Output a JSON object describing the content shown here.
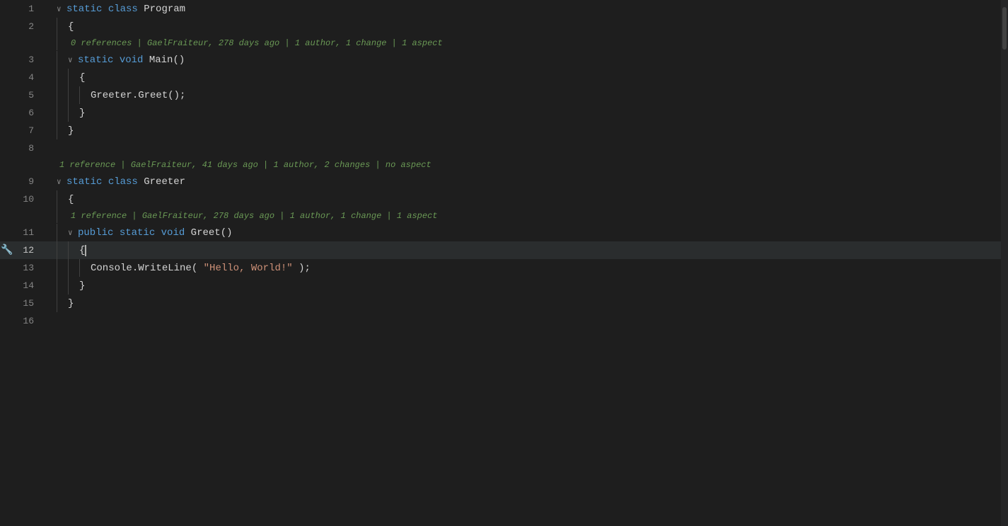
{
  "editor": {
    "background": "#1e1e1e",
    "activeLineBackground": "#2a2d2e",
    "colors": {
      "keyword": "#569cd6",
      "className": "#4ec9b0",
      "methodName": "#dcdcaa",
      "string": "#ce9178",
      "plain": "#d4d4d4",
      "metaInfo": "#6a9955",
      "lineNumber": "#858585",
      "activeLineNumber": "#c6c6c6"
    },
    "lines": [
      {
        "num": 1,
        "indent": 0,
        "foldable": true,
        "folded": false,
        "content": [
          {
            "type": "fold",
            "text": "∨"
          },
          {
            "type": "keyword",
            "text": "static"
          },
          {
            "type": "plain",
            "text": " "
          },
          {
            "type": "keyword",
            "text": "class"
          },
          {
            "type": "plain",
            "text": " "
          },
          {
            "type": "className",
            "text": "Program"
          }
        ],
        "active": false
      },
      {
        "num": 2,
        "indent": 1,
        "foldable": false,
        "content": [
          {
            "type": "plain",
            "text": "{"
          }
        ],
        "active": false
      },
      {
        "num": "meta1",
        "isMeta": true,
        "indent": 1,
        "content": "0 references | GaelFraiteur, 278 days ago | 1 author, 1 change | 1 aspect"
      },
      {
        "num": 3,
        "indent": 1,
        "foldable": true,
        "folded": false,
        "content": [
          {
            "type": "fold",
            "text": "∨"
          },
          {
            "type": "keyword",
            "text": "static"
          },
          {
            "type": "plain",
            "text": " "
          },
          {
            "type": "keyword",
            "text": "void"
          },
          {
            "type": "plain",
            "text": " "
          },
          {
            "type": "methodName",
            "text": "Main"
          },
          {
            "type": "plain",
            "text": "()"
          }
        ],
        "active": false
      },
      {
        "num": 4,
        "indent": 2,
        "content": [
          {
            "type": "plain",
            "text": "{"
          }
        ],
        "active": false
      },
      {
        "num": 5,
        "indent": 3,
        "content": [
          {
            "type": "className",
            "text": "Greeter"
          },
          {
            "type": "plain",
            "text": "."
          },
          {
            "type": "methodName",
            "text": "Greet"
          },
          {
            "type": "plain",
            "text": "();"
          }
        ],
        "active": false
      },
      {
        "num": 6,
        "indent": 2,
        "content": [
          {
            "type": "plain",
            "text": "}"
          }
        ],
        "active": false
      },
      {
        "num": 7,
        "indent": 1,
        "content": [
          {
            "type": "plain",
            "text": "}"
          }
        ],
        "active": false
      },
      {
        "num": 8,
        "indent": 0,
        "content": [],
        "active": false
      },
      {
        "num": "meta2",
        "isMeta": true,
        "indent": 0,
        "content": "1 reference | GaelFraiteur, 41 days ago | 1 author, 2 changes | no aspect"
      },
      {
        "num": 9,
        "indent": 0,
        "foldable": true,
        "folded": false,
        "content": [
          {
            "type": "fold",
            "text": "∨"
          },
          {
            "type": "keyword",
            "text": "static"
          },
          {
            "type": "plain",
            "text": " "
          },
          {
            "type": "keyword",
            "text": "class"
          },
          {
            "type": "plain",
            "text": " "
          },
          {
            "type": "className",
            "text": "Greeter"
          }
        ],
        "active": false
      },
      {
        "num": 10,
        "indent": 1,
        "content": [
          {
            "type": "plain",
            "text": "{"
          }
        ],
        "active": false
      },
      {
        "num": "meta3",
        "isMeta": true,
        "indent": 1,
        "content": "1 reference | GaelFraiteur, 278 days ago | 1 author, 1 change | 1 aspect"
      },
      {
        "num": 11,
        "indent": 1,
        "foldable": true,
        "folded": false,
        "content": [
          {
            "type": "fold",
            "text": "∨"
          },
          {
            "type": "keyword",
            "text": "public"
          },
          {
            "type": "plain",
            "text": " "
          },
          {
            "type": "keyword",
            "text": "static"
          },
          {
            "type": "plain",
            "text": " "
          },
          {
            "type": "keyword",
            "text": "void"
          },
          {
            "type": "plain",
            "text": " "
          },
          {
            "type": "methodName",
            "text": "Greet"
          },
          {
            "type": "plain",
            "text": "()"
          }
        ],
        "active": false
      },
      {
        "num": 12,
        "indent": 2,
        "isActive": true,
        "hasBreakpoint": true,
        "hasCursor": true,
        "content": [
          {
            "type": "plain",
            "text": "{"
          }
        ],
        "active": true
      },
      {
        "num": 13,
        "indent": 3,
        "content": [
          {
            "type": "className",
            "text": "Console"
          },
          {
            "type": "plain",
            "text": "."
          },
          {
            "type": "methodName",
            "text": "WriteLine"
          },
          {
            "type": "plain",
            "text": "( "
          },
          {
            "type": "string",
            "text": "\"Hello, World!\""
          },
          {
            "type": "plain",
            "text": " );"
          }
        ],
        "active": false
      },
      {
        "num": 14,
        "indent": 2,
        "content": [
          {
            "type": "plain",
            "text": "}"
          }
        ],
        "active": false
      },
      {
        "num": 15,
        "indent": 1,
        "content": [
          {
            "type": "plain",
            "text": "}"
          }
        ],
        "active": false
      },
      {
        "num": 16,
        "indent": 0,
        "content": [],
        "active": false
      }
    ]
  }
}
